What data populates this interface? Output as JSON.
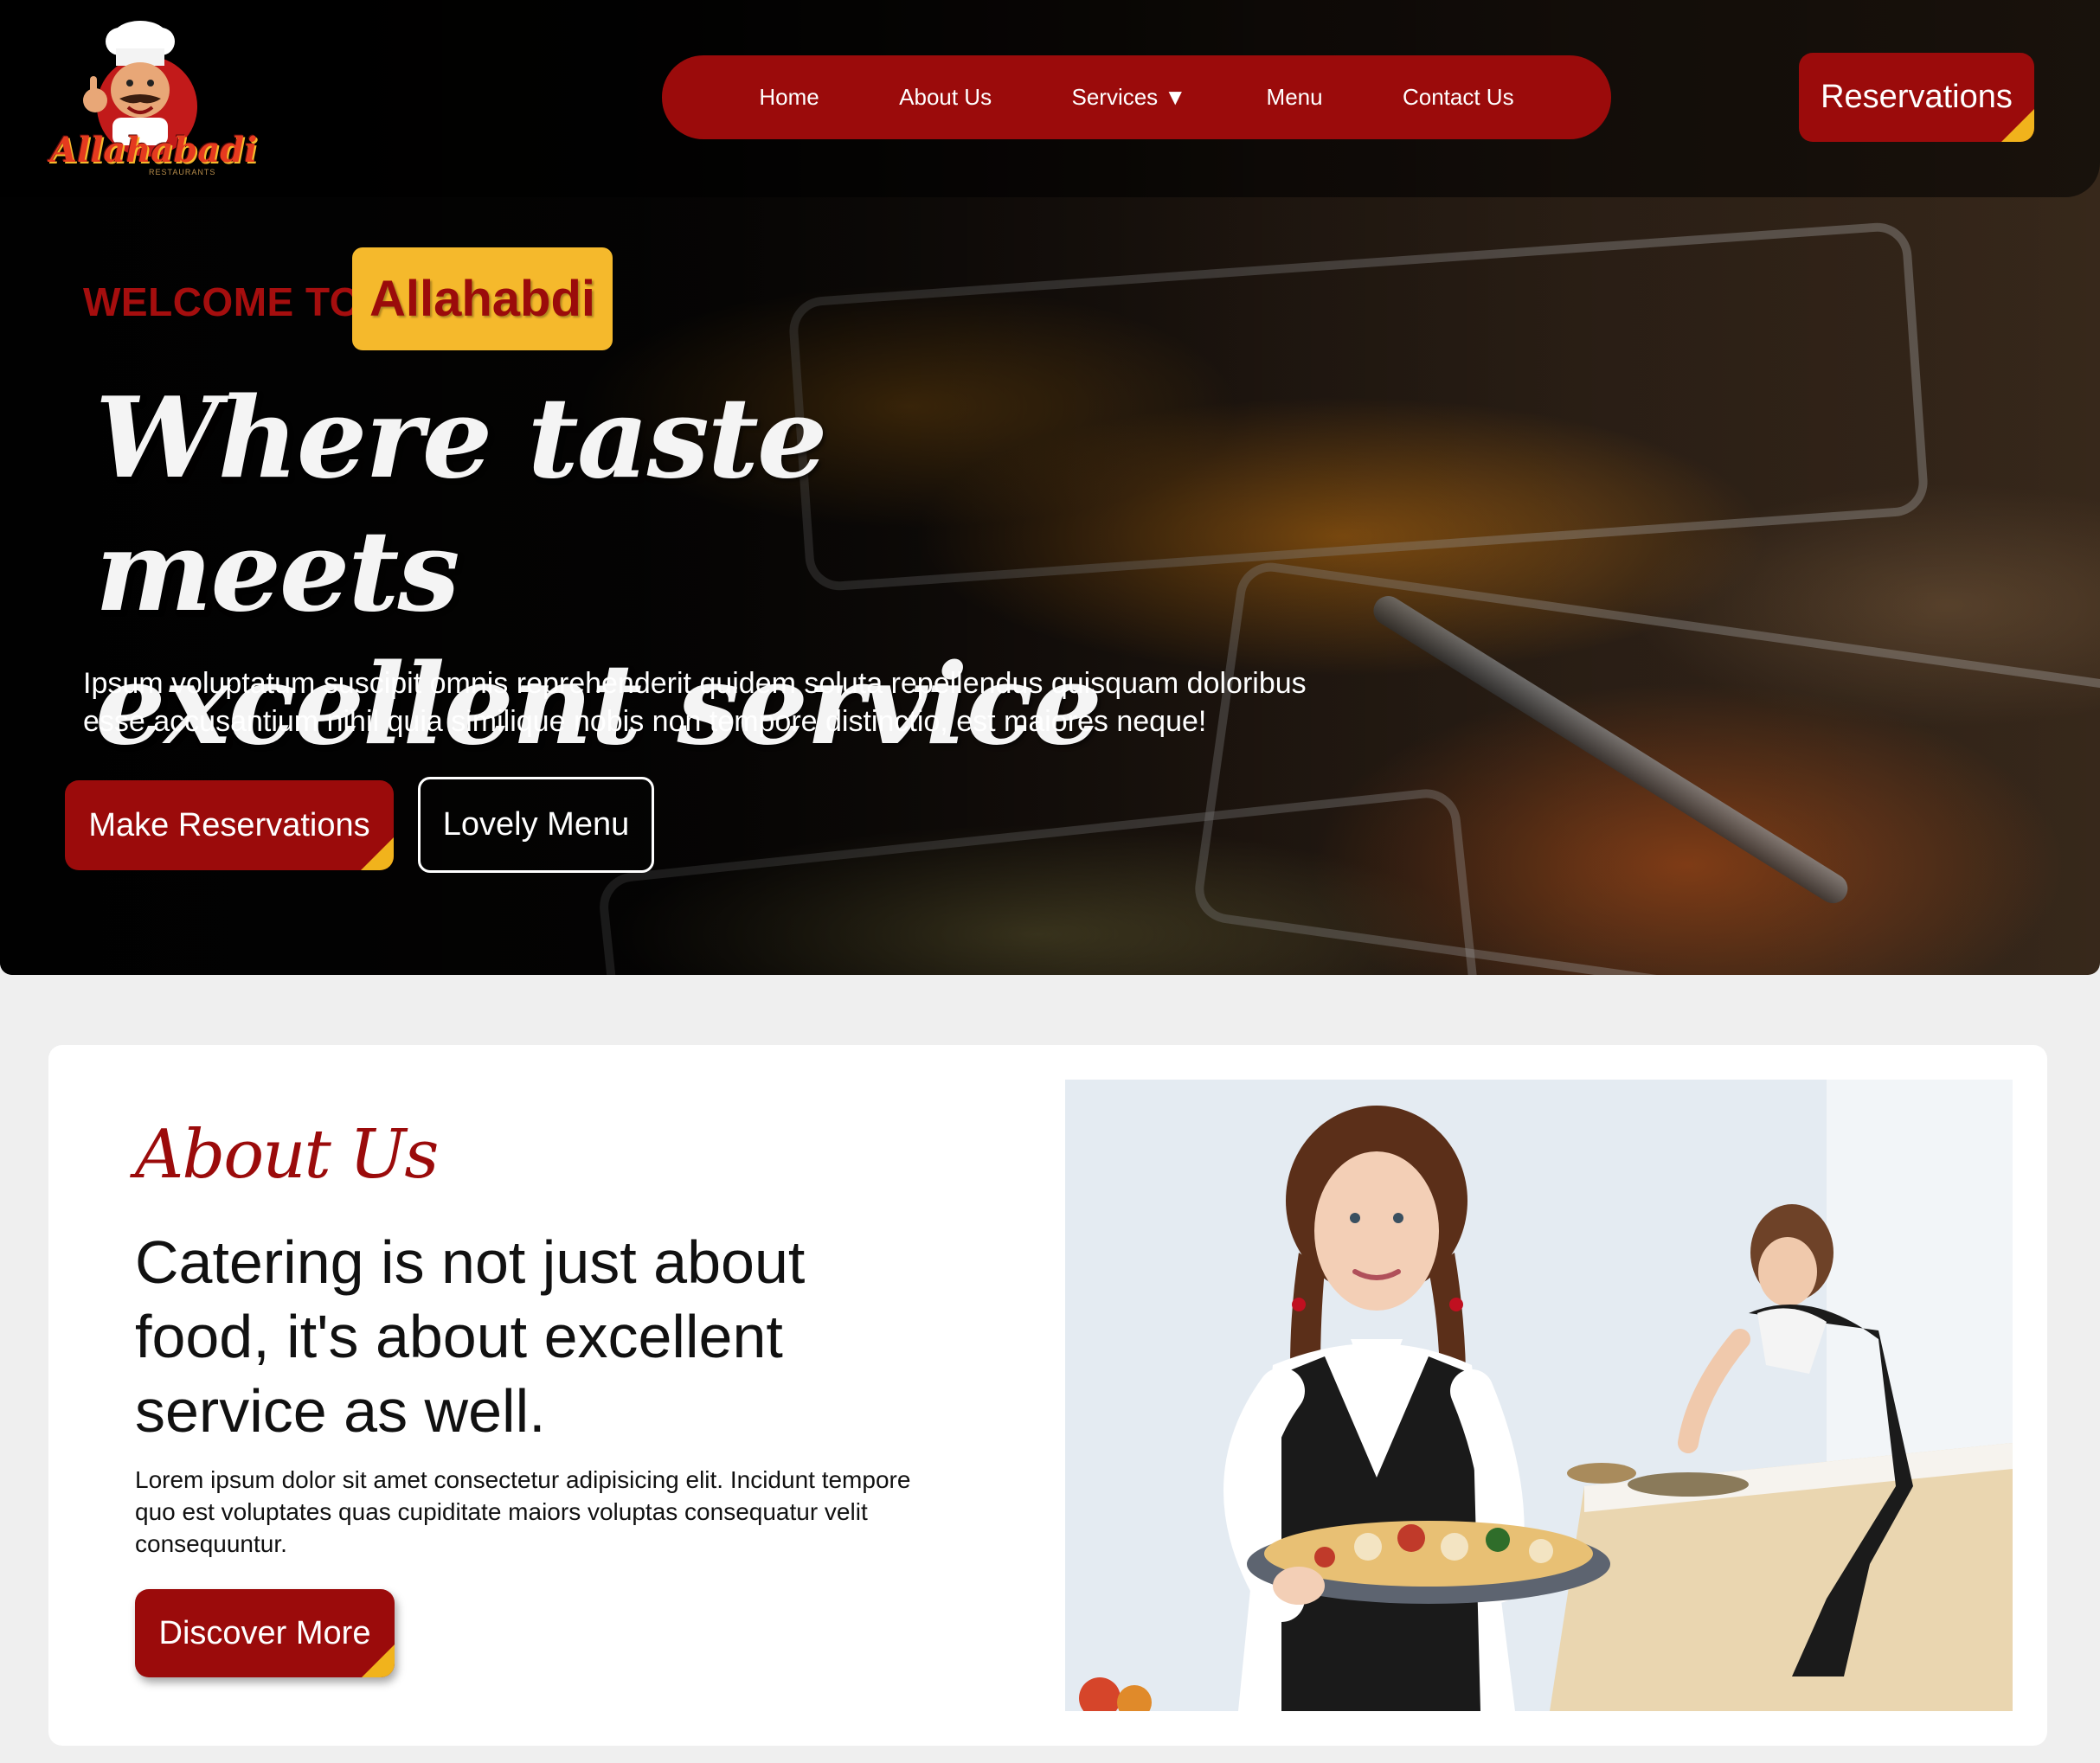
{
  "brand": {
    "logo_text": "Allahabadi",
    "logo_subtext": "RESTAURANTS"
  },
  "nav": {
    "items": [
      {
        "label": "Home"
      },
      {
        "label": "About Us"
      },
      {
        "label": "Services ▼"
      },
      {
        "label": "Menu"
      },
      {
        "label": "Contact Us"
      }
    ]
  },
  "header": {
    "reservations_label": "Reservations"
  },
  "hero": {
    "welcome_label": "WELCOME TO",
    "welcome_badge": "Allahabdi",
    "title_line1": "Where taste meets",
    "title_line2": "excellent service",
    "text_line1": "Ipsum voluptatum suscipit omnis reprehenderit quidem soluta repellendus quisquam doloribus",
    "text_line2": "esse accusantium nihil quia similique nobis non tempore distinctio, est maiores neque!",
    "primary_button": "Make Reservations",
    "secondary_button": "Lovely Menu"
  },
  "about": {
    "script_title": "About Us",
    "heading_line1": "Catering is not just about",
    "heading_line2": "food, it's about excellent",
    "heading_line3": "service as well.",
    "text_line1": "Lorem ipsum dolor sit amet consectetur adipisicing elit. Incidunt tempore",
    "text_line2": "quo est voluptates quas cupiditate maiors voluptas consequatur velit",
    "text_line3": "consequuntur.",
    "button_label": "Discover More"
  },
  "colors": {
    "brand_red": "#9b0b0b",
    "accent_yellow": "#f5b92c",
    "page_bg": "#efefef"
  }
}
